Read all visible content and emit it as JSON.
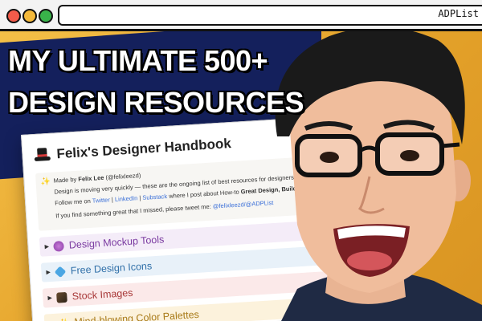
{
  "window": {
    "url_text": "ADPList"
  },
  "headline": {
    "line1": "MY ULTIMATE 500+",
    "line2": "DESIGN RESOURCES"
  },
  "doc": {
    "title": "Felix's Designer Handbook",
    "callout": {
      "made_by_prefix": "Made by ",
      "made_by_name": "Felix Lee",
      "made_by_handle": " (@felixleezd)",
      "line2": "Design is moving very quickly — these are the ongoing list of best resources for designers. If you found this h",
      "line3_prefix": "Follow me on ",
      "twitter": "Twitter",
      "sep1": " | ",
      "linkedin": "LinkedIn",
      "sep2": " | ",
      "substack": "Substack",
      "line3_suffix": " where I post about How-to ",
      "line3_bold": "Great Design, Building Products & Acce",
      "line4_prefix": "If you find something great that I missed, please tweet me: ",
      "line4_link": "@felixleezd/@ADPList"
    },
    "toggles": [
      {
        "label": "Design Mockup Tools"
      },
      {
        "label": "Free Design Icons"
      },
      {
        "label": "Stock Images"
      },
      {
        "label": "Mind-blowing Color Palettes"
      }
    ]
  }
}
